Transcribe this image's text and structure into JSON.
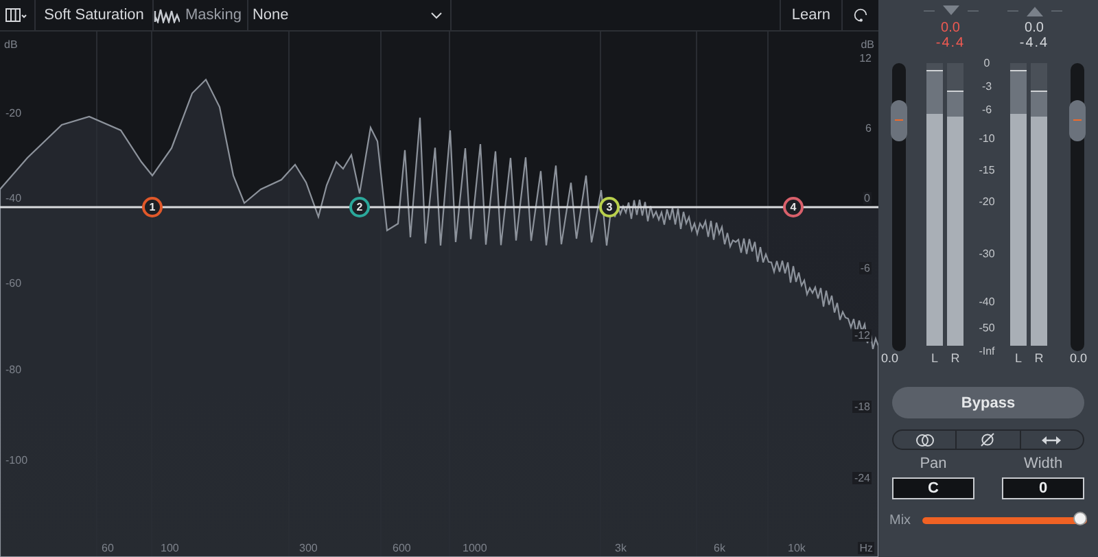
{
  "toolbar": {
    "preset": "Soft Saturation",
    "masking_label": "Masking",
    "masking_value": "None",
    "learn_button": "Learn"
  },
  "graph": {
    "left_unit": "dB",
    "left_ticks": [
      "-20",
      "-40",
      "-60",
      "-80",
      "-100"
    ],
    "right_unit": "dB",
    "right_ticks": [
      "12",
      "6",
      "0",
      "-6",
      "-12",
      "-18",
      "-24"
    ],
    "frequency_ticks": [
      "60",
      "100",
      "300",
      "600",
      "1000",
      "3k",
      "6k",
      "10k"
    ],
    "frequency_unit": "Hz",
    "nodes": [
      {
        "label": "1",
        "color": "#e0582a"
      },
      {
        "label": "2",
        "color": "#2ba89b"
      },
      {
        "label": "3",
        "color": "#b9d04c"
      },
      {
        "label": "4",
        "color": "#d9606b"
      }
    ]
  },
  "meters": {
    "input": {
      "peak": "0.0",
      "rms": "-4.4",
      "clipping": true,
      "gain": "0.0",
      "gain_slider": {
        "level": 0.8
      },
      "channels": [
        {
          "label": "L",
          "level": 0.82,
          "peak_hold": {
            "level": 0.97
          }
        },
        {
          "label": "R",
          "level": 0.81,
          "peak_hold": {
            "level": 0.9
          }
        }
      ]
    },
    "output": {
      "peak": "0.0",
      "rms": "-4.4",
      "clipping": false,
      "gain": "0.0",
      "gain_slider": {
        "level": 0.8
      },
      "channels": [
        {
          "label": "L",
          "level": 0.82,
          "peak_hold": {
            "level": 0.97
          }
        },
        {
          "label": "R",
          "level": 0.81,
          "peak_hold": {
            "level": 0.9
          }
        }
      ]
    },
    "scale": [
      "0",
      "-3",
      "-6",
      "-10",
      "-15",
      "-20",
      "-30",
      "-40",
      "-50",
      "-Inf"
    ]
  },
  "bypass_button": "Bypass",
  "pan": {
    "label": "Pan",
    "value": "C"
  },
  "width": {
    "label": "Width",
    "value": "0"
  },
  "mix": {
    "label": "Mix",
    "level": 1.0
  }
}
